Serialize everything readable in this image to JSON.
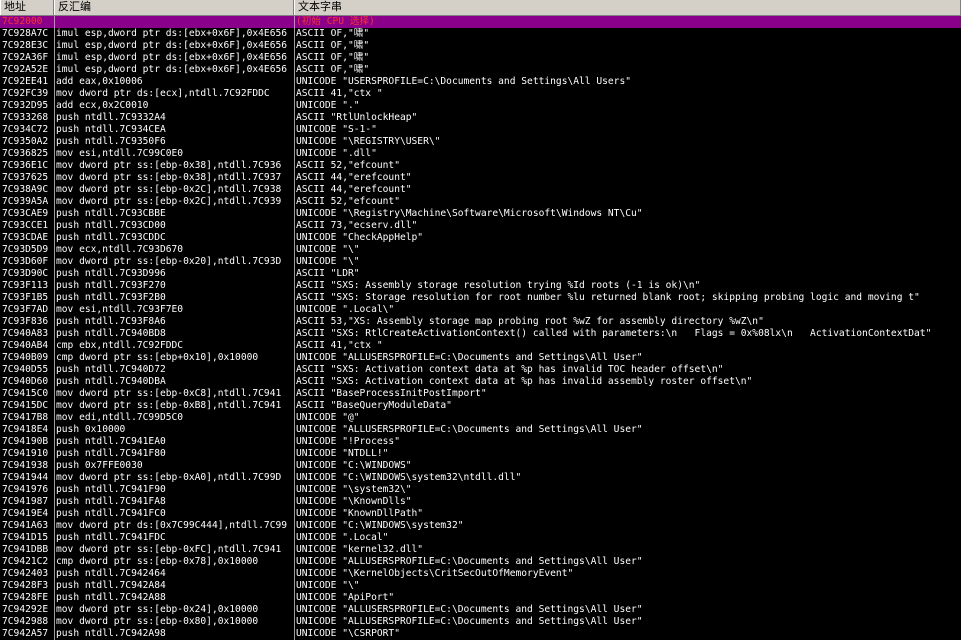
{
  "header": {
    "address": "地址",
    "disassembly": "反汇编",
    "text_string": "文本字串"
  },
  "colors": {
    "background": "#000000",
    "text": "#ffffff",
    "selected_row_bg": "#8a008a",
    "selected_row_text": "#ff3030",
    "header_bg": "#d4d0c8"
  },
  "rows": [
    {
      "addr": "7C92000",
      "dis": "",
      "txt": "(初始 CPU 选择)",
      "selected": true
    },
    {
      "addr": "7C928A7C",
      "dis": "imul esp,dword ptr ds:[ebx+0x6F],0x4E656",
      "txt": "ASCII OF,\"啸\""
    },
    {
      "addr": "7C928E3C",
      "dis": "imul esp,dword ptr ds:[ebx+0x6F],0x4E656",
      "txt": "ASCII OF,\"啸\""
    },
    {
      "addr": "7C92A36F",
      "dis": "imul esp,dword ptr ds:[ebx+0x6F],0x4E656",
      "txt": "ASCII OF,\"啸\""
    },
    {
      "addr": "7C92A52E",
      "dis": "imul esp,dword ptr ds:[ebx+0x6F],0x4E656",
      "txt": "ASCII OF,\"啸\""
    },
    {
      "addr": "7C92EE41",
      "dis": "add eax,0x10006",
      "txt": "UNICODE \"USERSPROFILE=C:\\Documents and Settings\\All Users\""
    },
    {
      "addr": "7C92FC39",
      "dis": "mov dword ptr ds:[ecx],ntdll.7C92FDDC",
      "txt": "ASCII 41,\"ctx \""
    },
    {
      "addr": "7C932D95",
      "dis": "add ecx,0x2C0010",
      "txt": "UNICODE \".\""
    },
    {
      "addr": "7C933268",
      "dis": "push ntdll.7C9332A4",
      "txt": "ASCII \"RtlUnlockHeap\""
    },
    {
      "addr": "7C934C72",
      "dis": "push ntdll.7C934CEA",
      "txt": "UNICODE \"S-1-\""
    },
    {
      "addr": "7C9350A2",
      "dis": "push ntdll.7C9350F6",
      "txt": "UNICODE \"\\REGISTRY\\USER\\\""
    },
    {
      "addr": "7C936825",
      "dis": "mov esi,ntdll.7C99C0E0",
      "txt": "UNICODE \".dll\""
    },
    {
      "addr": "7C936E1C",
      "dis": "mov dword ptr ss:[ebp-0x38],ntdll.7C936",
      "txt": "ASCII 52,\"efcount\""
    },
    {
      "addr": "7C937625",
      "dis": "mov dword ptr ss:[ebp-0x38],ntdll.7C937",
      "txt": "ASCII 44,\"erefcount\""
    },
    {
      "addr": "7C938A9C",
      "dis": "mov dword ptr ss:[ebp-0x2C],ntdll.7C938",
      "txt": "ASCII 44,\"erefcount\""
    },
    {
      "addr": "7C939A5A",
      "dis": "mov dword ptr ss:[ebp-0x2C],ntdll.7C939",
      "txt": "ASCII 52,\"efcount\""
    },
    {
      "addr": "7C93CAE9",
      "dis": "push ntdll.7C93CBBE",
      "txt": "UNICODE \"\\Registry\\Machine\\Software\\Microsoft\\Windows NT\\Cu\""
    },
    {
      "addr": "7C93CCE1",
      "dis": "push ntdll.7C93CD00",
      "txt": "ASCII 73,\"ecserv.dll\""
    },
    {
      "addr": "7C93CDAE",
      "dis": "push ntdll.7C93CDDC",
      "txt": "UNICODE \"CheckAppHelp\""
    },
    {
      "addr": "7C93D5D9",
      "dis": "mov ecx,ntdll.7C93D670",
      "txt": "UNICODE \"\\\""
    },
    {
      "addr": "7C93D60F",
      "dis": "mov dword ptr ss:[ebp-0x20],ntdll.7C93D",
      "txt": "UNICODE \"\\\""
    },
    {
      "addr": "7C93D90C",
      "dis": "push ntdll.7C93D996",
      "txt": "ASCII \"LDR\""
    },
    {
      "addr": "7C93F113",
      "dis": "push ntdll.7C93F270",
      "txt": "ASCII \"SXS: Assembly storage resolution trying %Id roots (-1 is ok)\\n\""
    },
    {
      "addr": "7C93F1B5",
      "dis": "push ntdll.7C93F2B0",
      "txt": "ASCII \"SXS: Storage resolution for root number %lu returned blank root; skipping probing logic and moving t\""
    },
    {
      "addr": "7C93F7AD",
      "dis": "mov esi,ntdll.7C93F7E0",
      "txt": "UNICODE \".Local\\\""
    },
    {
      "addr": "7C93F836",
      "dis": "push ntdll.7C93F8A6",
      "txt": "ASCII 53,\"XS: Assembly storage map probing root %wZ for assembly directory %wZ\\n\""
    },
    {
      "addr": "7C940A83",
      "dis": "push ntdll.7C940BD8",
      "txt": "ASCII \"SXS: RtlCreateActivationContext() called with parameters:\\n   Flags = 0x%08lx\\n   ActivationContextDat\""
    },
    {
      "addr": "7C940AB4",
      "dis": "cmp ebx,ntdll.7C92FDDC",
      "txt": "ASCII 41,\"ctx \""
    },
    {
      "addr": "7C940B09",
      "dis": "cmp dword ptr ss:[ebp+0x10],0x10000",
      "txt": "UNICODE \"ALLUSERSPROFILE=C:\\Documents and Settings\\All User\""
    },
    {
      "addr": "7C940D55",
      "dis": "push ntdll.7C940D72",
      "txt": "ASCII \"SXS: Activation context data at %p has invalid TOC header offset\\n\""
    },
    {
      "addr": "7C940D60",
      "dis": "push ntdll.7C940DBA",
      "txt": "ASCII \"SXS: Activation context data at %p has invalid assembly roster offset\\n\""
    },
    {
      "addr": "7C9415C0",
      "dis": "mov dword ptr ss:[ebp-0xC8],ntdll.7C941",
      "txt": "ASCII \"BaseProcessInitPostImport\""
    },
    {
      "addr": "7C9415DC",
      "dis": "mov dword ptr ss:[ebp-0xB8],ntdll.7C941",
      "txt": "ASCII \"BaseQueryModuleData\""
    },
    {
      "addr": "7C9417B8",
      "dis": "mov edi,ntdll.7C99D5C0",
      "txt": "UNICODE \"@\""
    },
    {
      "addr": "7C9418E4",
      "dis": "push 0x10000",
      "txt": "UNICODE \"ALLUSERSPROFILE=C:\\Documents and Settings\\All User\""
    },
    {
      "addr": "7C94190B",
      "dis": "push ntdll.7C941EA0",
      "txt": "UNICODE \"!Process\""
    },
    {
      "addr": "7C941910",
      "dis": "push ntdll.7C941F80",
      "txt": "UNICODE \"NTDLL!\""
    },
    {
      "addr": "7C941938",
      "dis": "push 0x7FFE0030",
      "txt": "UNICODE \"C:\\WINDOWS\""
    },
    {
      "addr": "7C941944",
      "dis": "mov dword ptr ss:[ebp-0xA0],ntdll.7C99D",
      "txt": "UNICODE \"C:\\WINDOWS\\system32\\ntdll.dll\""
    },
    {
      "addr": "7C941976",
      "dis": "push ntdll.7C941F90",
      "txt": "UNICODE \"\\system32\\\""
    },
    {
      "addr": "7C941987",
      "dis": "push ntdll.7C941FA8",
      "txt": "UNICODE \"\\KnownDlls\""
    },
    {
      "addr": "7C9419E4",
      "dis": "push ntdll.7C941FC0",
      "txt": "UNICODE \"KnownDllPath\""
    },
    {
      "addr": "7C941A63",
      "dis": "mov dword ptr ds:[0x7C99C444],ntdll.7C99",
      "txt": "UNICODE \"C:\\WINDOWS\\system32\""
    },
    {
      "addr": "7C941D15",
      "dis": "push ntdll.7C941FDC",
      "txt": "UNICODE \".Local\""
    },
    {
      "addr": "7C941DBB",
      "dis": "mov dword ptr ss:[ebp-0xFC],ntdll.7C941",
      "txt": "UNICODE \"kernel32.dll\""
    },
    {
      "addr": "7C9421C2",
      "dis": "cmp dword ptr ss:[ebp-0x78],0x10000",
      "txt": "UNICODE \"ALLUSERSPROFILE=C:\\Documents and Settings\\All User\""
    },
    {
      "addr": "7C942403",
      "dis": "push ntdll.7C942464",
      "txt": "UNICODE \"\\KernelObjects\\CritSecOutOfMemoryEvent\""
    },
    {
      "addr": "7C9428F3",
      "dis": "push ntdll.7C942A84",
      "txt": "UNICODE \"\\\""
    },
    {
      "addr": "7C9428FE",
      "dis": "push ntdll.7C942A88",
      "txt": "UNICODE \"ApiPort\""
    },
    {
      "addr": "7C94292E",
      "dis": "mov dword ptr ss:[ebp-0x24],0x10000",
      "txt": "UNICODE \"ALLUSERSPROFILE=C:\\Documents and Settings\\All User\""
    },
    {
      "addr": "7C942988",
      "dis": "mov dword ptr ss:[ebp-0x80],0x10000",
      "txt": "UNICODE \"ALLUSERSPROFILE=C:\\Documents and Settings\\All User\""
    },
    {
      "addr": "7C942A57",
      "dis": "push ntdll.7C942A98",
      "txt": "UNICODE \"\\CSRPORT\""
    }
  ]
}
